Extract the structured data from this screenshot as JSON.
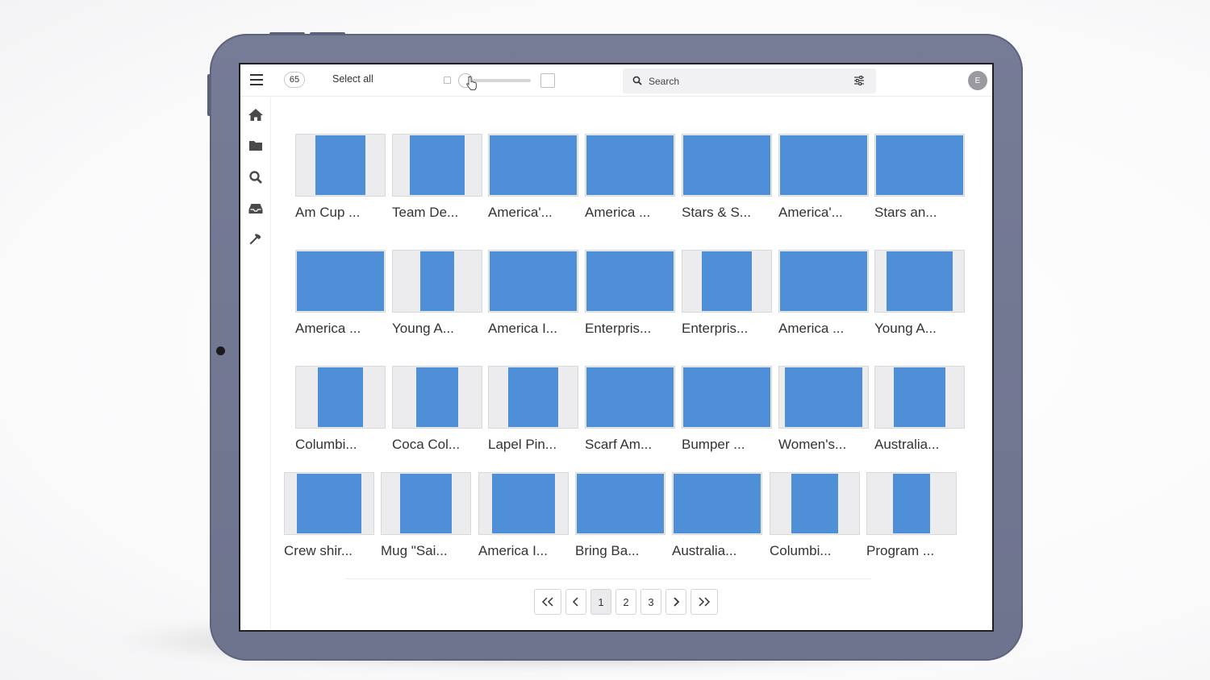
{
  "toolbar": {
    "count": "65",
    "select_all_label": "Select all",
    "search_placeholder": "Search"
  },
  "user": {
    "avatar_initial": "E"
  },
  "sidebar": {
    "items": [
      {
        "name": "home",
        "icon": "home-icon"
      },
      {
        "name": "folders",
        "icon": "folder-icon"
      },
      {
        "name": "search",
        "icon": "search-icon"
      },
      {
        "name": "inbox",
        "icon": "inbox-icon"
      },
      {
        "name": "tools",
        "icon": "hammer-icon"
      }
    ]
  },
  "items": [
    {
      "caption": "Am Cup ..."
    },
    {
      "caption": "Team De..."
    },
    {
      "caption": "America'..."
    },
    {
      "caption": "America ..."
    },
    {
      "caption": "Stars & S..."
    },
    {
      "caption": "America'..."
    },
    {
      "caption": "Stars an..."
    },
    {
      "caption": "America ..."
    },
    {
      "caption": "Young A..."
    },
    {
      "caption": "America I..."
    },
    {
      "caption": "Enterpris..."
    },
    {
      "caption": "Enterpris..."
    },
    {
      "caption": "America ..."
    },
    {
      "caption": "Young A..."
    },
    {
      "caption": "Columbi..."
    },
    {
      "caption": "Coca Col..."
    },
    {
      "caption": "Lapel Pin..."
    },
    {
      "caption": "Scarf Am..."
    },
    {
      "caption": "Bumper ..."
    },
    {
      "caption": "Women's..."
    },
    {
      "caption": "Australia..."
    },
    {
      "caption": "Crew shir..."
    },
    {
      "caption": "Mug \"Sai..."
    },
    {
      "caption": "America I..."
    },
    {
      "caption": "Bring Ba..."
    },
    {
      "caption": "Australia..."
    },
    {
      "caption": "Columbi..."
    },
    {
      "caption": "Program ..."
    }
  ],
  "pagination": {
    "first": "<<",
    "prev": "<",
    "pages": [
      "1",
      "2",
      "3"
    ],
    "current": "1",
    "next": ">",
    "last": ">>"
  },
  "colors": {
    "thumb_blue": "#4f8fd8",
    "tablet_frame": "#767b96"
  }
}
